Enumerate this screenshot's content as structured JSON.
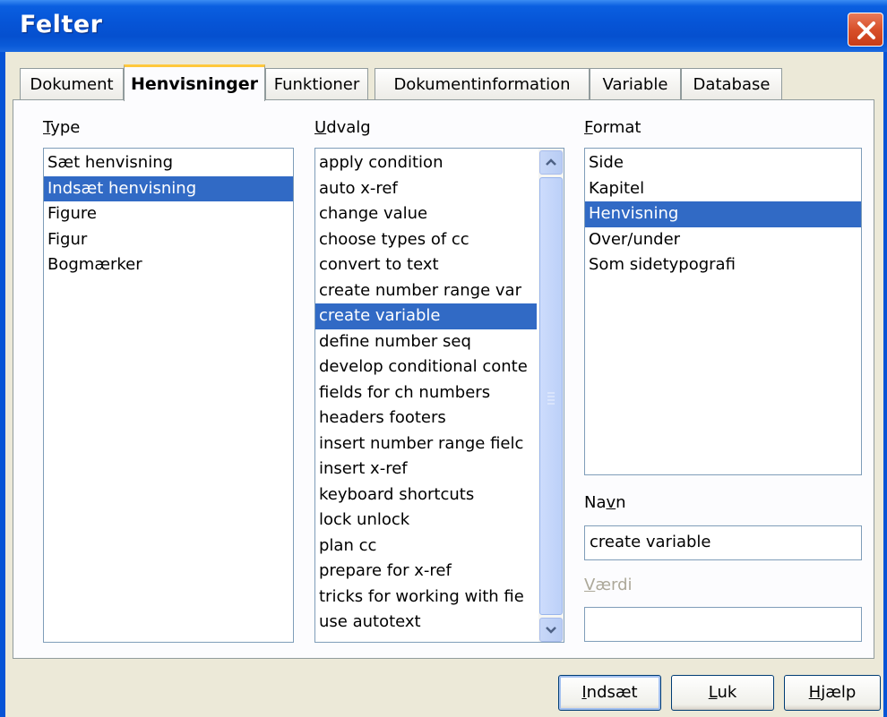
{
  "window": {
    "title": "Felter"
  },
  "tabs": [
    {
      "label": "Dokument"
    },
    {
      "label": "Henvisninger"
    },
    {
      "label": "Funktioner"
    },
    {
      "label": "Dokumentinformation"
    },
    {
      "label": "Variable"
    },
    {
      "label": "Database"
    }
  ],
  "active_tab": "Henvisninger",
  "type_section": {
    "label_mnemonic": "T",
    "label_rest": "ype",
    "items": [
      "Sæt henvisning",
      "Indsæt henvisning",
      "Figure",
      "Figur",
      "Bogmærker"
    ],
    "selected": "Indsæt henvisning"
  },
  "select_section": {
    "label_mnemonic": "U",
    "label_rest": "dvalg",
    "items": [
      "apply condition",
      "auto x-ref",
      "change value",
      "choose types of cc",
      "convert to text",
      "create number range var",
      "create variable",
      "define number seq",
      "develop conditional conte",
      "fields for ch numbers",
      "headers footers",
      "insert number range fielc",
      "insert x-ref",
      "keyboard shortcuts",
      "lock unlock",
      "plan cc",
      "prepare for x-ref",
      "tricks for working with fie",
      "use autotext"
    ],
    "selected": "create variable"
  },
  "format_section": {
    "label_mnemonic": "F",
    "label_rest": "ormat",
    "items": [
      "Side",
      "Kapitel",
      "Henvisning",
      "Over/under",
      "Som sidetypografi"
    ],
    "selected": "Henvisning"
  },
  "name_field": {
    "label_pre": "Na",
    "label_mnemonic": "v",
    "label_post": "n",
    "value": "create variable"
  },
  "value_field": {
    "label_mnemonic": "V",
    "label_rest": "ærdi",
    "value": ""
  },
  "buttons": {
    "insert_mnemonic": "I",
    "insert_rest": "ndsæt",
    "close_mnemonic": "L",
    "close_rest": "uk",
    "help_mnemonic": "H",
    "help_rest": "jælp"
  },
  "colors": {
    "selection": "#316ac5",
    "titlebar": "#0654d6",
    "active_tab_accent": "#ffc83c"
  }
}
